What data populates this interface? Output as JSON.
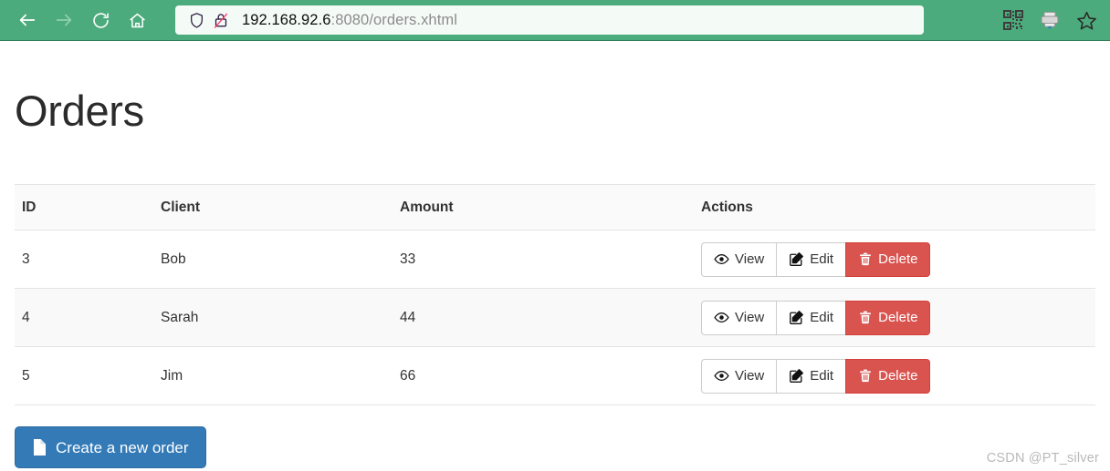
{
  "browser": {
    "nav": {
      "back_label": "Back",
      "forward_label": "Forward",
      "reload_label": "Reload",
      "home_label": "Home"
    },
    "address_bar": {
      "host": "192.168.92.6",
      "path": ":8080/orders.xhtml",
      "full_url": "192.168.92.6:8080/orders.xhtml",
      "shield_icon": "shield-icon",
      "insecure_icon": "lock-crossed-icon"
    },
    "toolbar_right": [
      {
        "name": "qr-code-icon",
        "label": "QR code"
      },
      {
        "name": "printer-icon",
        "label": "Print"
      },
      {
        "name": "star-icon",
        "label": "Bookmark"
      }
    ],
    "colors": {
      "toolbar_bg": "#4cab7c",
      "toolbar_border": "#2f7d57",
      "urlbar_bg": "#f4faf6"
    }
  },
  "page": {
    "title": "Orders",
    "table": {
      "columns": [
        "ID",
        "Client",
        "Amount",
        "Actions"
      ],
      "rows": [
        {
          "id": "3",
          "client": "Bob",
          "amount": "33"
        },
        {
          "id": "4",
          "client": "Sarah",
          "amount": "44"
        },
        {
          "id": "5",
          "client": "Jim",
          "amount": "66"
        }
      ],
      "actions": {
        "view_label": "View",
        "edit_label": "Edit",
        "delete_label": "Delete",
        "view_icon": "eye-icon",
        "edit_icon": "pencil-square-icon",
        "delete_icon": "trash-icon"
      }
    },
    "create_button": {
      "label": "Create a new order",
      "icon": "file-icon"
    },
    "colors": {
      "primary": "#337ab7",
      "danger": "#d9534f",
      "stripe": "#f9f9f9",
      "border": "#e4e4e4"
    }
  },
  "watermark": "CSDN @PT_silver"
}
